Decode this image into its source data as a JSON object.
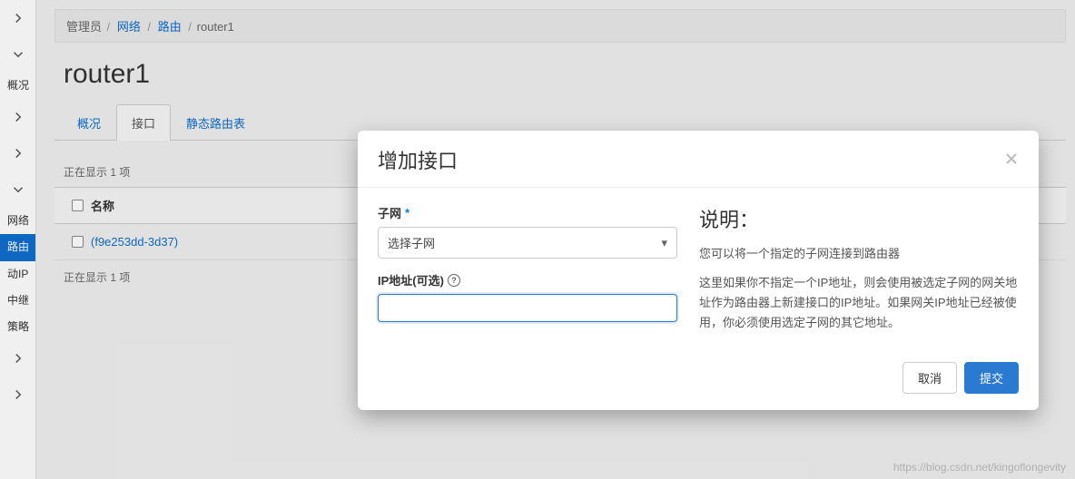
{
  "sidebar": {
    "labels": {
      "overview": "概况",
      "network": "网络",
      "routes": "路由",
      "floating_ip": "动IP",
      "relay": "中继",
      "policy": "策略"
    }
  },
  "breadcrumb": {
    "admin": "管理员",
    "network": "网络",
    "routes": "路由",
    "current": "router1"
  },
  "page": {
    "title": "router1"
  },
  "tabs": {
    "overview": "概况",
    "interface": "接口",
    "static_routes": "静态路由表"
  },
  "table": {
    "showing_top": "正在显示 1 项",
    "col_name": "名称",
    "row0_name": "(f9e253dd-3d37)",
    "showing_bottom": "正在显示 1 项"
  },
  "modal": {
    "title": "增加接口",
    "subnet_label": "子网",
    "subnet_selected": "选择子网",
    "ip_label": "IP地址(可选)",
    "ip_value": "",
    "desc_title": "说明：",
    "desc_p1": "您可以将一个指定的子网连接到路由器",
    "desc_p2": "这里如果你不指定一个IP地址，则会使用被选定子网的网关地址作为路由器上新建接口的IP地址。如果网关IP地址已经被使用，你必须使用选定子网的其它地址。",
    "cancel": "取消",
    "submit": "提交"
  },
  "watermark": "https://blog.csdn.net/kingoflongevity"
}
